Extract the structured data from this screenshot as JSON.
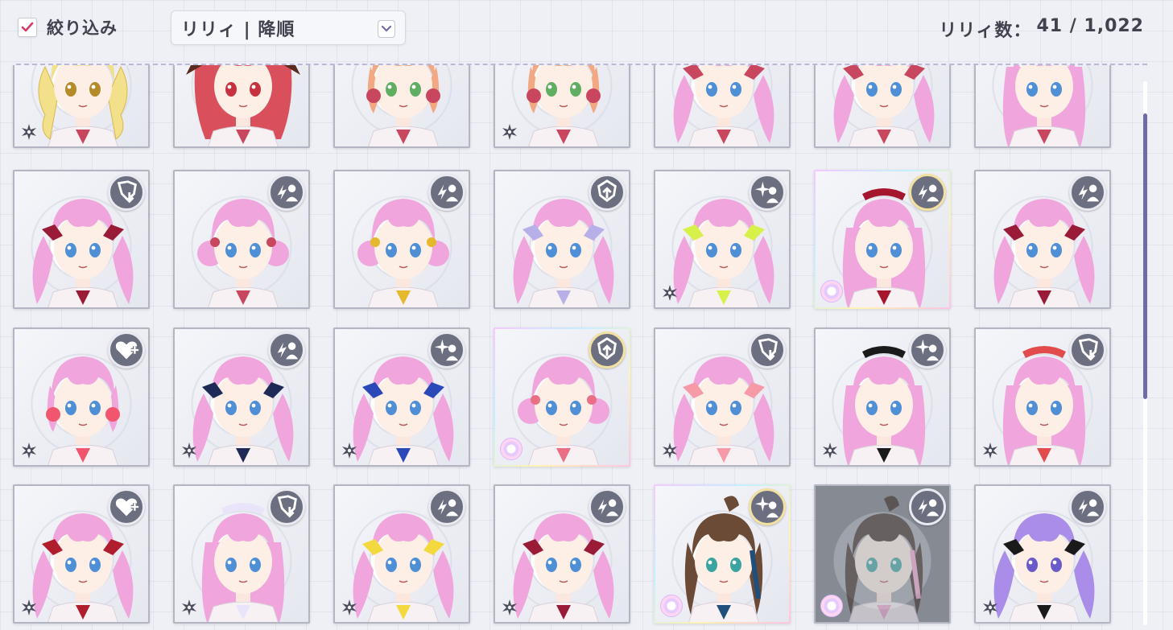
{
  "header": {
    "filter_label": "絞り込み",
    "filter_checked": true,
    "sort_value": "リリィ | 降順",
    "count_label": "リリィ数：",
    "count_value": "41 / 1,022"
  },
  "colors": {
    "accent": "#d63a6b",
    "badge": "#6c6f80",
    "scroll_thumb": "#6e6ca8",
    "divider": "#b9b8d8"
  },
  "grid": {
    "columns": 7,
    "cards": [
      {
        "hair": "#f3e08a",
        "eyes": "#b58a2a",
        "role": "",
        "attr": true,
        "frame": "normal",
        "style": "drills"
      },
      {
        "hair": "#d9505c",
        "eyes": "#c8313e",
        "role": "",
        "attr": false,
        "frame": "normal",
        "style": "horns"
      },
      {
        "hair": "#f2a883",
        "eyes": "#5fae62",
        "role": "",
        "attr": false,
        "frame": "normal",
        "style": "short"
      },
      {
        "hair": "#f2a883",
        "eyes": "#5fae62",
        "role": "",
        "attr": true,
        "frame": "normal",
        "style": "short"
      },
      {
        "hair": "#f0a6dd",
        "eyes": "#4f8fd6",
        "role": "",
        "attr": false,
        "frame": "normal",
        "style": "twin"
      },
      {
        "hair": "#f0a6dd",
        "eyes": "#4f8fd6",
        "role": "",
        "attr": false,
        "frame": "normal",
        "style": "twin"
      },
      {
        "hair": "#f0a6dd",
        "eyes": "#4f8fd6",
        "role": "",
        "attr": false,
        "frame": "normal",
        "style": "long"
      },
      {
        "hair": "#f0a6dd",
        "eyes": "#4f8fd6",
        "role": "shield-down-icon",
        "attr": false,
        "frame": "normal",
        "style": "twin",
        "ribbon": "#9a1b38"
      },
      {
        "hair": "#f0a6dd",
        "eyes": "#4f8fd6",
        "role": "lightning-person-icon",
        "attr": false,
        "frame": "normal",
        "style": "buns"
      },
      {
        "hair": "#f0a6dd",
        "eyes": "#4f8fd6",
        "role": "lightning-person-icon",
        "attr": false,
        "frame": "normal",
        "style": "buns",
        "ribbon": "#e6b92c"
      },
      {
        "hair": "#f0a6dd",
        "eyes": "#4f8fd6",
        "role": "shield-up-icon",
        "attr": false,
        "frame": "normal",
        "style": "twin",
        "ribbon": "#b7b0e8"
      },
      {
        "hair": "#f0a6dd",
        "eyes": "#4f8fd6",
        "role": "sparkle-person-icon",
        "attr": true,
        "frame": "normal",
        "style": "twin",
        "ribbon": "#d8f04a"
      },
      {
        "hair": "#f0a6dd",
        "eyes": "#4f8fd6",
        "role": "lightning-person-icon",
        "attr": false,
        "frame": "rainbow",
        "style": "long",
        "ribbon": "#a5162e"
      },
      {
        "hair": "#f0a6dd",
        "eyes": "#4f8fd6",
        "role": "lightning-person-icon",
        "attr": false,
        "frame": "normal",
        "style": "twin",
        "ribbon": "#9a1b38"
      },
      {
        "hair": "#f0a6dd",
        "eyes": "#4f8fd6",
        "role": "heart-plus-icon",
        "attr": true,
        "frame": "normal",
        "style": "short",
        "ribbon": "#f2566e"
      },
      {
        "hair": "#f0a6dd",
        "eyes": "#4f8fd6",
        "role": "lightning-person-icon",
        "attr": true,
        "frame": "normal",
        "style": "twin",
        "ribbon": "#1e2a55"
      },
      {
        "hair": "#f0a6dd",
        "eyes": "#4f8fd6",
        "role": "sparkle-person-icon",
        "attr": true,
        "frame": "normal",
        "style": "twin",
        "ribbon": "#2a48b8"
      },
      {
        "hair": "#f0a6dd",
        "eyes": "#4f8fd6",
        "role": "shield-up-icon",
        "attr": false,
        "frame": "rainbow",
        "style": "buns",
        "ribbon": "#ea6f85"
      },
      {
        "hair": "#f0a6dd",
        "eyes": "#4f8fd6",
        "role": "shield-down-icon",
        "attr": true,
        "frame": "normal",
        "style": "twin",
        "ribbon": "#f69aa8"
      },
      {
        "hair": "#f0a6dd",
        "eyes": "#4f8fd6",
        "role": "sparkle-person-icon",
        "attr": true,
        "frame": "normal",
        "style": "long",
        "ribbon": "#1a1a1a"
      },
      {
        "hair": "#f0a6dd",
        "eyes": "#4f8fd6",
        "role": "shield-down-icon",
        "attr": true,
        "frame": "normal",
        "style": "long",
        "ribbon": "#e24b4b"
      },
      {
        "hair": "#f0a6dd",
        "eyes": "#4f8fd6",
        "role": "heart-plus-icon",
        "attr": true,
        "frame": "normal",
        "style": "twin",
        "ribbon": "#b01e2e"
      },
      {
        "hair": "#f0a6dd",
        "eyes": "#4f8fd6",
        "role": "shield-down-icon",
        "attr": true,
        "frame": "normal",
        "style": "long",
        "ribbon": "#e9e4f9"
      },
      {
        "hair": "#f0a6dd",
        "eyes": "#4f8fd6",
        "role": "lightning-person-icon",
        "attr": true,
        "frame": "normal",
        "style": "twin",
        "ribbon": "#f3d93e"
      },
      {
        "hair": "#f0a6dd",
        "eyes": "#4f8fd6",
        "role": "lightning-person-icon",
        "attr": true,
        "frame": "normal",
        "style": "twin",
        "ribbon": "#9a1b38"
      },
      {
        "hair": "#6b4a36",
        "eyes": "#3ba3a0",
        "role": "sparkle-person-icon",
        "attr": false,
        "frame": "rainbow",
        "style": "ponytail",
        "ribbon": "#1f4f7a"
      },
      {
        "hair": "#3a2a25",
        "eyes": "#3ba3a0",
        "role": "lightning-person-icon",
        "attr": false,
        "frame": "dim",
        "style": "ponytail",
        "ribbon": "#f0a7cf"
      },
      {
        "hair": "#a98de8",
        "eyes": "#6a5cc8",
        "role": "lightning-person-icon",
        "attr": true,
        "frame": "normal",
        "style": "twin",
        "ribbon": "#1a1a1a"
      }
    ]
  }
}
